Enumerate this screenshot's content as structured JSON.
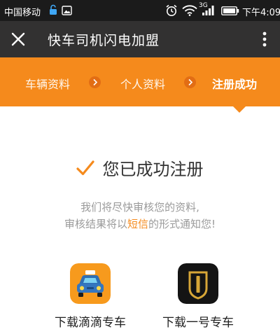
{
  "status_bar": {
    "carrier": "中国移动",
    "network_type": "3G",
    "time": "下午4:09"
  },
  "title_bar": {
    "title": "快车司机闪电加盟"
  },
  "steps": [
    {
      "label": "车辆资料",
      "active": false
    },
    {
      "label": "个人资料",
      "active": false
    },
    {
      "label": "注册成功",
      "active": true
    }
  ],
  "success": {
    "message": "您已成功注册"
  },
  "notice": {
    "line1": "我们将尽快审核您的资料,",
    "line2_before": "审核结果将以",
    "line2_highlight": "短信",
    "line2_after": "的形式通知您!"
  },
  "apps": [
    {
      "label": "下载滴滴专车",
      "icon": "didi-car-icon"
    },
    {
      "label": "下载一号专车",
      "icon": "yihao-car-icon"
    }
  ],
  "colors": {
    "accent": "#f58a1c",
    "title_bar": "#323131",
    "status_bar": "#1b1b1b"
  }
}
